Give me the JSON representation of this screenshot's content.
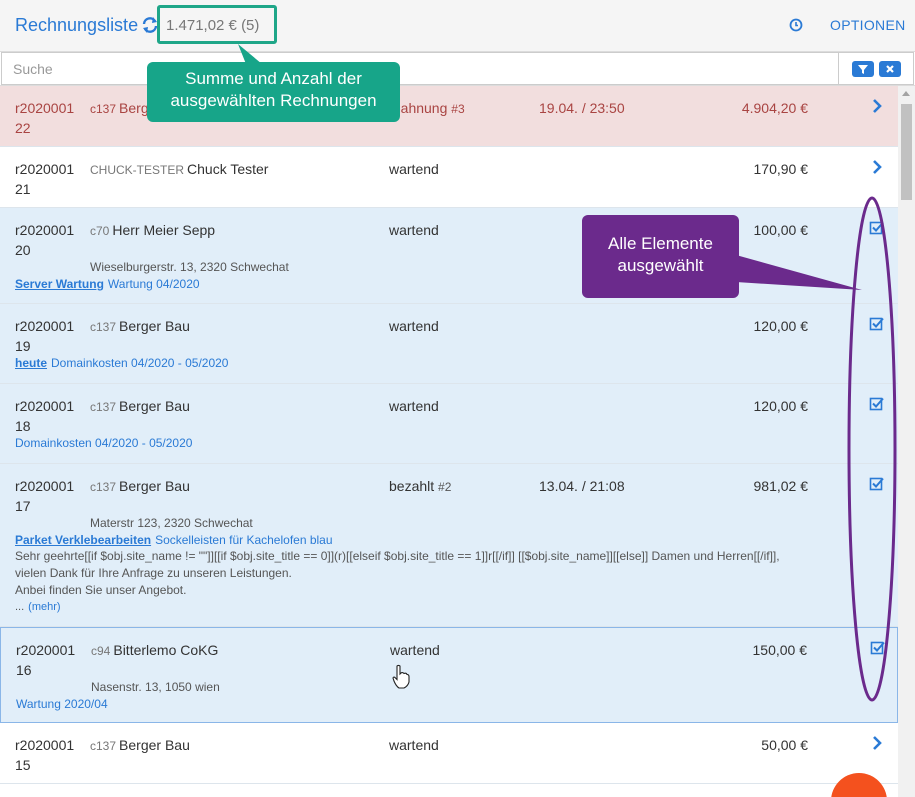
{
  "header": {
    "title": "Rechnungsliste",
    "summary": "1.471,02 € (5)",
    "options_label": "OPTIONEN"
  },
  "search": {
    "placeholder": "Suche"
  },
  "callouts": {
    "summary_note": "Summe und Anzahl der ausgewählten Rechnungen",
    "selection_note": "Alle Elemente ausgewählt"
  },
  "invoices": [
    {
      "id": "r202000122",
      "customer_code": "c137",
      "customer_name": "Berg",
      "status": "Mahnung",
      "status_num": "#3",
      "date": "19.04. / 23:50",
      "amount": "4.904,20 €"
    },
    {
      "id": "r202000121",
      "customer_code": "CHUCK-TESTER",
      "customer_name": "Chuck Tester",
      "status": "wartend",
      "amount": "170,90 €"
    },
    {
      "id": "r202000120",
      "customer_code": "c70",
      "customer_name": "Herr Meier Sepp",
      "status": "wartend",
      "amount": "100,00 €",
      "address": "Wieselburgerstr. 13, 2320 Schwechat",
      "project_link": "Server Wartung",
      "project_text": "Wartung 04/2020"
    },
    {
      "id": "r202000119",
      "customer_code": "c137",
      "customer_name": "Berger Bau",
      "status": "wartend",
      "amount": "120,00 €",
      "project_link": "heute",
      "project_text": "Domainkosten 04/2020 - 05/2020"
    },
    {
      "id": "r202000118",
      "customer_code": "c137",
      "customer_name": "Berger Bau",
      "status": "wartend",
      "amount": "120,00 €",
      "project_text": "Domainkosten 04/2020 - 05/2020"
    },
    {
      "id": "r202000117",
      "customer_code": "c137",
      "customer_name": "Berger Bau",
      "status": "bezahlt",
      "status_num": "#2",
      "date": "13.04. / 21:08",
      "amount": "981,02 €",
      "address": "Materstr 123, 2320 Schwechat",
      "project_link": "Parket Verklebearbeiten",
      "project_text": "Sockelleisten für Kachelofen blau",
      "note_1": "Sehr geehrte[[if $obj.site_name != \"\"]][[if $obj.site_title == 0]](r)[[elseif $obj.site_title == 1]]r[[/if]] [[$obj.site_name]][[else]] Damen und Herren[[/if]],",
      "note_2": "vielen Dank für Ihre Anfrage zu unseren Leistungen.",
      "note_3": "Anbei finden Sie unser Angebot.",
      "ellipsis": "...",
      "more": "(mehr)"
    },
    {
      "id": "r202000116",
      "customer_code": "c94",
      "customer_name": "Bitterlemo CoKG",
      "status": "wartend",
      "amount": "150,00 €",
      "address": "Nasenstr. 13, 1050 wien",
      "project_text": "Wartung 2020/04"
    },
    {
      "id": "r202000115",
      "customer_code": "c137",
      "customer_name": "Berger Bau",
      "status": "wartend",
      "amount": "50,00 €"
    }
  ],
  "colors": {
    "accent": "#2a7ad5",
    "dunning_bg": "#f2dede",
    "selected_bg": "#e1eef9",
    "callout_green": "#17a589",
    "callout_purple": "#6b2a8c",
    "fab": "#f4511e"
  },
  "icons": {
    "refresh": "refresh-icon",
    "clock": "clock-icon",
    "filter": "filter-icon",
    "clear": "close-icon",
    "open": "chevron-right-icon",
    "selected": "checkbox-checked-icon",
    "cursor": "hand-cursor-icon"
  }
}
